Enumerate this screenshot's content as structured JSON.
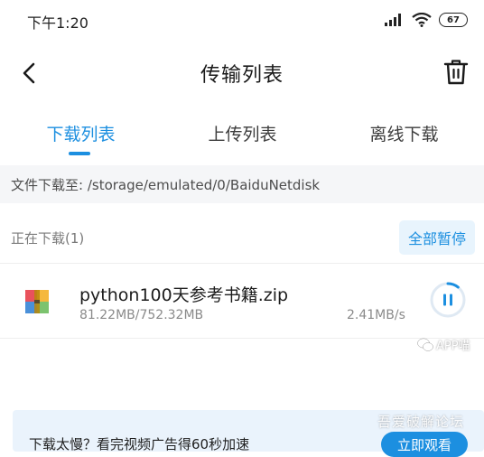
{
  "status_bar": {
    "time": "下午1:20",
    "battery": "67",
    "icons": [
      "signal-icon",
      "wifi-icon",
      "battery-icon"
    ]
  },
  "nav": {
    "title": "传输列表",
    "back_icon": "chevron-left-icon",
    "trash_icon": "trash-icon"
  },
  "tabs": [
    {
      "label": "下载列表",
      "active": true
    },
    {
      "label": "上传列表",
      "active": false
    },
    {
      "label": "离线下载",
      "active": false
    }
  ],
  "path_bar": {
    "text": "文件下载至: /storage/emulated/0/BaiduNetdisk"
  },
  "downloading": {
    "label": "正在下载(1)",
    "pause_all": "全部暂停",
    "items": [
      {
        "name": "python100天参考书籍.zip",
        "progress": "81.22MB/752.32MB",
        "speed": "2.41MB/s",
        "progress_fraction": 0.108,
        "icon": "zip-archive-icon"
      }
    ]
  },
  "ad": {
    "text": "下载太慢？看完视频广告得60秒加速",
    "button": "立即观看"
  },
  "watermark": {
    "text": "吾爱破解论坛",
    "wechat_label": "APP喵"
  },
  "colors": {
    "accent": "#1c8fe0",
    "accent_light": "#e8f4fd",
    "path_bg": "#f5f6f8"
  }
}
